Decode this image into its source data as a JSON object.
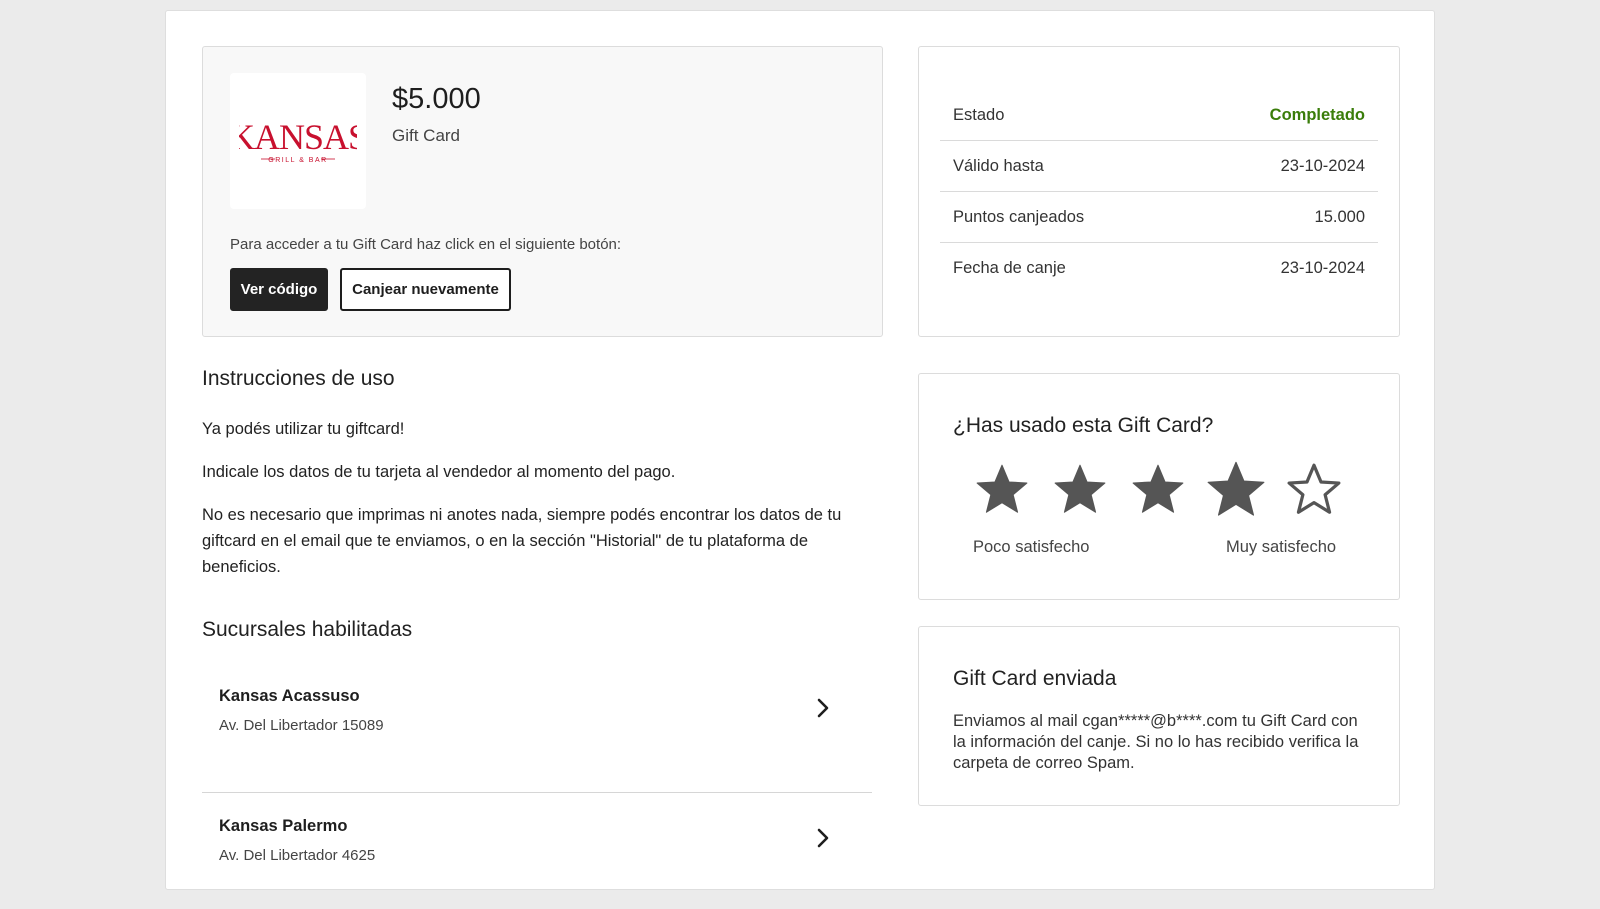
{
  "product": {
    "brand_logo_text": "KANSAS",
    "brand_logo_subtext": "GRILL & BAR",
    "price": "$5.000",
    "type": "Gift Card",
    "access_text": "Para acceder a tu Gift Card haz click en el siguiente botón:",
    "view_code_label": "Ver código",
    "redeem_again_label": "Canjear nuevamente"
  },
  "instructions": {
    "title": "Instrucciones de uso",
    "paragraphs": [
      "Ya podés utilizar tu giftcard!",
      "Indicale los datos de tu tarjeta al vendedor al momento del pago.",
      "No es necesario que imprimas ni anotes nada, siempre podés encontrar los datos de tu giftcard en el email que te enviamos, o en la sección \"Historial\" de tu plataforma de beneficios."
    ]
  },
  "branches": {
    "title": "Sucursales habilitadas",
    "items": [
      {
        "name": "Kansas Acassuso",
        "address": "Av. Del Libertador 15089"
      },
      {
        "name": "Kansas Palermo",
        "address": "Av. Del Libertador 4625"
      }
    ]
  },
  "status": {
    "rows": [
      {
        "label": "Estado",
        "value": "Completado"
      },
      {
        "label": "Válido hasta",
        "value": "23-10-2024"
      },
      {
        "label": "Puntos canjeados",
        "value": "15.000"
      },
      {
        "label": "Fecha de canje",
        "value": "23-10-2024"
      }
    ]
  },
  "rating": {
    "title": "¿Has usado esta Gift Card?",
    "value": 4,
    "max": 5,
    "low_label": "Poco satisfecho",
    "high_label": "Muy satisfecho"
  },
  "sent": {
    "title": "Gift Card enviada",
    "text": "Enviamos al mail cgan*****@b****.com tu Gift Card con la información del canje. Si no lo has recibido verifica la carpeta de correo Spam."
  },
  "colors": {
    "primary_button": "#232323",
    "status_ok": "#3a7d0a",
    "brand_red": "#c8102e",
    "star": "#555555"
  },
  "icons": {
    "branch_arrow": "chevron-right-icon",
    "star_filled": "star-filled-icon",
    "star_empty": "star-outline-icon"
  }
}
